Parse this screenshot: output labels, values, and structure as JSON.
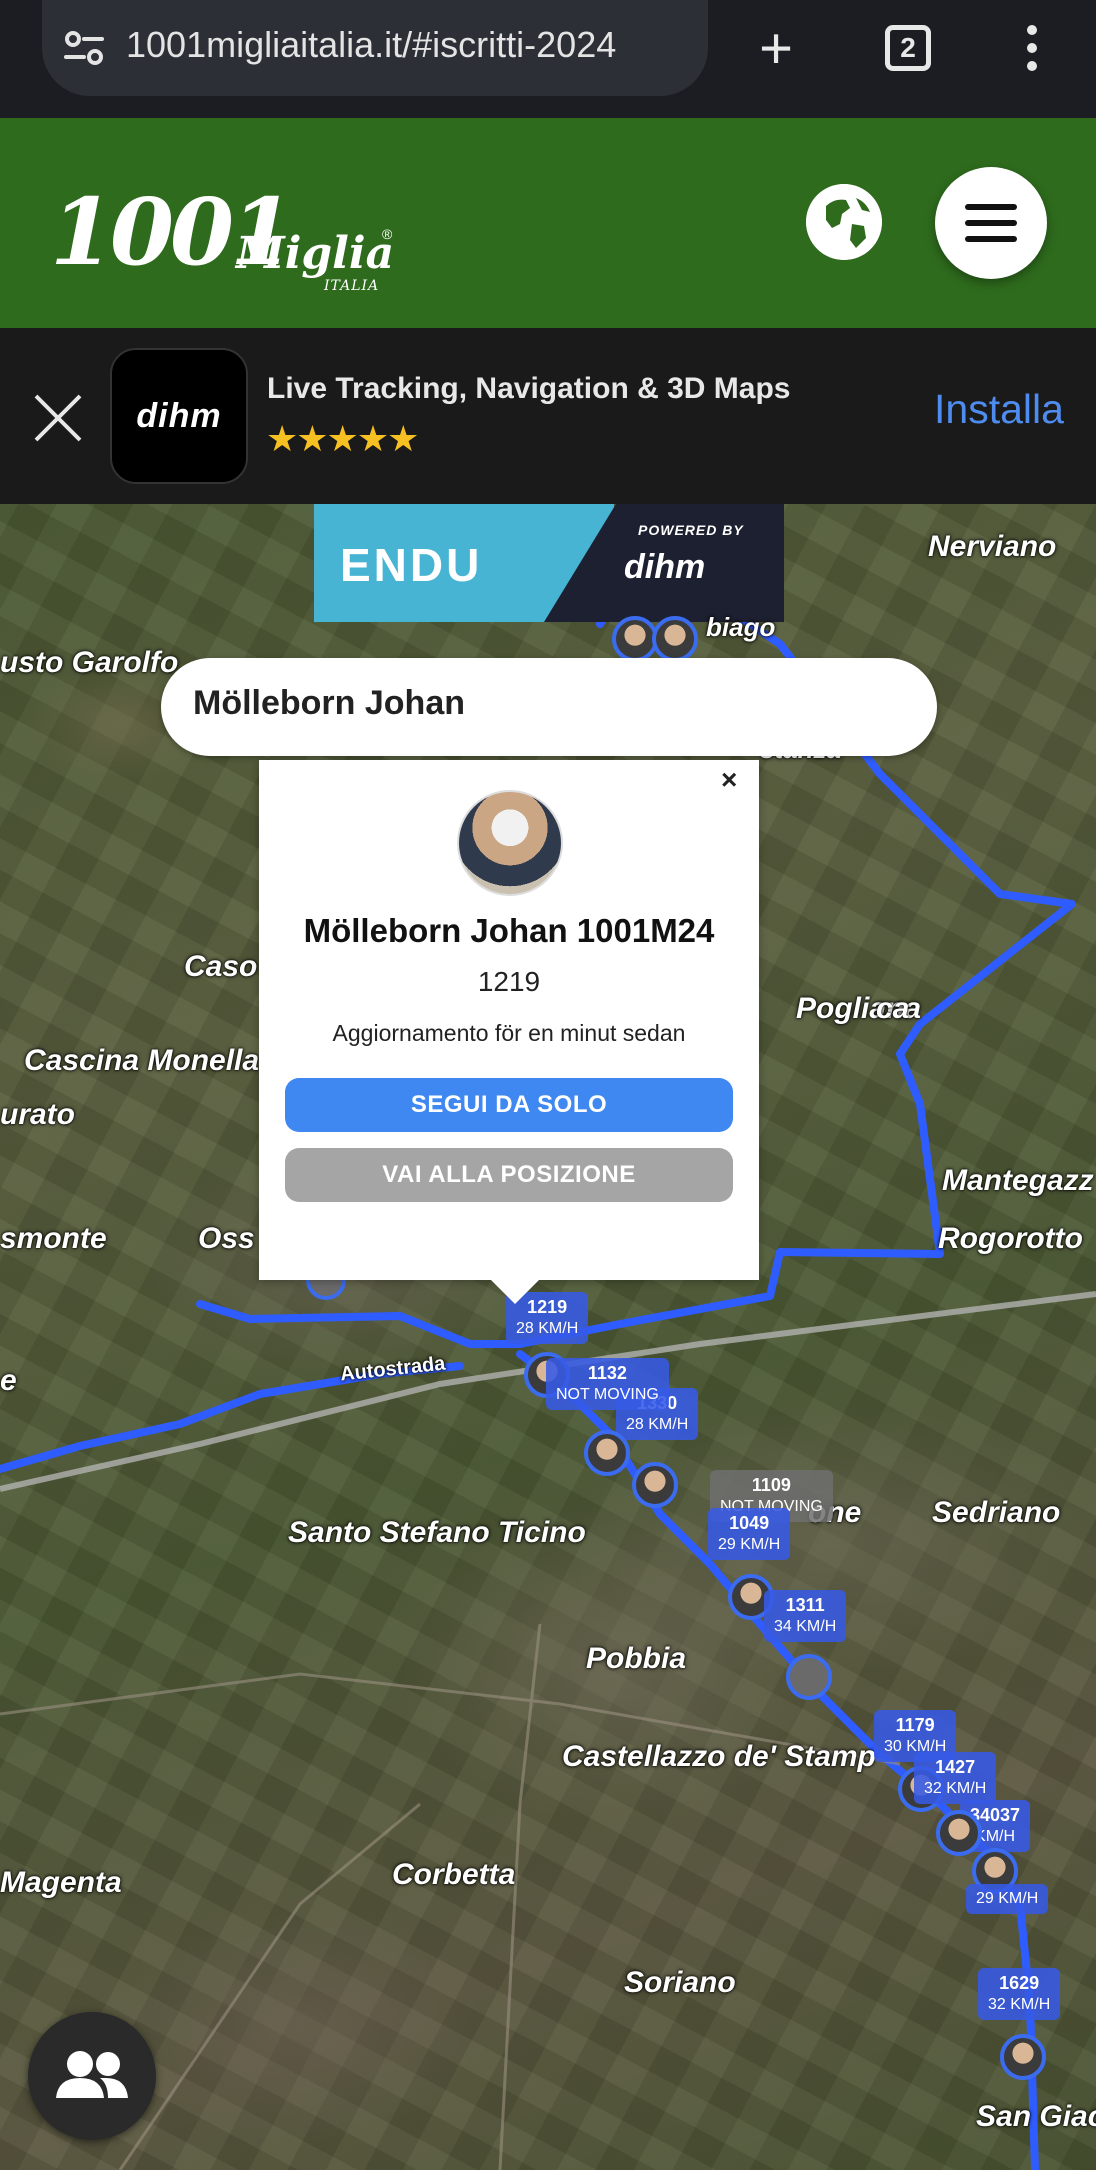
{
  "browser": {
    "url": "1001migliaitalia.it/#iscritti-2024",
    "tab_count": "2",
    "icons": [
      "site-info-icon",
      "plus-icon",
      "tabs-icon",
      "more-vert-icon"
    ]
  },
  "site": {
    "logo_number": "1001",
    "logo_word": "Miglia",
    "logo_sub": "ITALIA",
    "logo_reg": "®",
    "colors": {
      "header_bg": "#2e6b1d",
      "follow_button": "#3f88f2",
      "goto_button": "#a5a5a5",
      "route": "#2f5cff"
    }
  },
  "app_banner": {
    "title": "Live Tracking, Navigation & 3D Maps",
    "icon_text": "dihm",
    "stars": "★★★★★",
    "install_label": "Installa"
  },
  "map": {
    "endu_label": "ENDU",
    "powered_by": "POWERED BY",
    "dihm_label": "dihm",
    "search_value": "Mölleborn Johan",
    "places": [
      "Nerviano",
      "usto Garolfo",
      "Caso",
      "Cascina Monella",
      "urato",
      "smonte",
      "Oss",
      "e",
      "Pogliana",
      "Mantegazz",
      "Rogorotto",
      "Sedriano",
      "Santo Stefano Ticino",
      "Pobbia",
      "Castellazzo de' Stamp",
      "Magenta",
      "Corbetta",
      "Soriano",
      "San Giac",
      "Autostrada",
      "biago",
      "stanza",
      "ca",
      "one"
    ],
    "popup": {
      "close": "×",
      "name": "Mölleborn Johan 1001M24",
      "bib": "1219",
      "update": "Aggiornamento för en minut sedan",
      "follow_label": "SEGUI DA SOLO",
      "goto_label": "VAI ALLA POSIZIONE"
    },
    "riders": [
      {
        "bib": "1219",
        "speed": "28 KM/H"
      },
      {
        "bib": "1132",
        "speed": "NOT MOVING"
      },
      {
        "bib": "1330",
        "speed": "28 KM/H"
      },
      {
        "bib": "1109",
        "speed": "NOT MOVING"
      },
      {
        "bib": "1049",
        "speed": "29 KM/H"
      },
      {
        "bib": "1311",
        "speed": "34 KM/H"
      },
      {
        "bib": "1179",
        "speed": "30 KM/H"
      },
      {
        "bib": "1427",
        "speed": "32 KM/H"
      },
      {
        "bib": "34037",
        "speed": "KM/H"
      },
      {
        "bib": "",
        "speed": "29 KM/H"
      },
      {
        "bib": "1629",
        "speed": "32 KM/H"
      }
    ]
  }
}
